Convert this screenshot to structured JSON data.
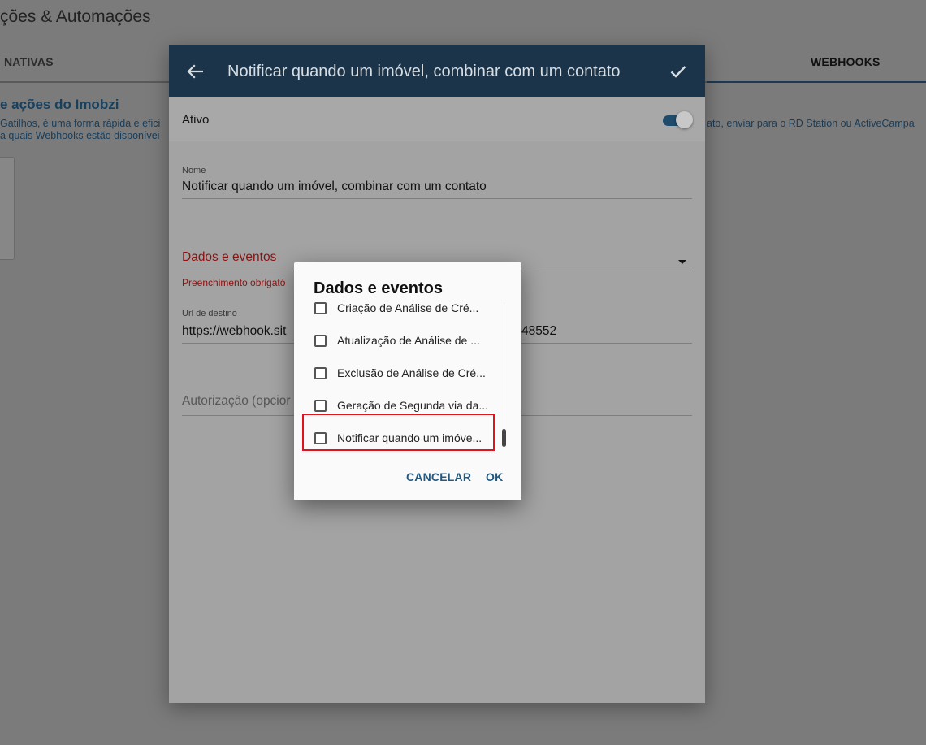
{
  "background": {
    "page_title": "ções & Automações",
    "tabs": [
      {
        "label": "NATIVAS"
      },
      {
        "label": "WEBHOOKS"
      }
    ],
    "section_title": "e ações do Imobzi",
    "description_line1": "Gatilhos, é uma forma rápida e efici",
    "description_line2": "a quais Webhooks estão disponívei",
    "description_right": "ato, enviar para o RD Station ou ActiveCampa"
  },
  "modal": {
    "title": "Notificar quando um imóvel, combinar com um contato",
    "back_icon": "arrow-left-icon",
    "confirm_icon": "check-icon",
    "active": {
      "label": "Ativo",
      "enabled": true,
      "accent_color": "#1e4a6b"
    },
    "fields": {
      "nome": {
        "label": "Nome",
        "value": "Notificar quando um imóvel, combinar com um contato"
      },
      "dados_eventos": {
        "label": "Dados e eventos",
        "helper": "Preenchimento obrigató",
        "error_color": "#8e1010"
      },
      "url": {
        "label": "Url de destino",
        "value_start": "https://webhook.sit",
        "value_end": "48552"
      },
      "autorizacao": {
        "placeholder": "Autorização (opcior"
      }
    }
  },
  "dialog": {
    "title": "Dados e eventos",
    "items": [
      {
        "label": "Criação de Análise de Cré...",
        "checked": false
      },
      {
        "label": "Atualização de Análise de ...",
        "checked": false
      },
      {
        "label": "Exclusão de Análise de Cré...",
        "checked": false
      },
      {
        "label": "Geração de Segunda via da...",
        "checked": false
      },
      {
        "label": "Notificar quando um imóve...",
        "checked": false
      }
    ],
    "highlighted_item_index": 4,
    "highlight_color": "#e0141a",
    "actions": {
      "cancel": "CANCELAR",
      "ok": "OK"
    }
  }
}
